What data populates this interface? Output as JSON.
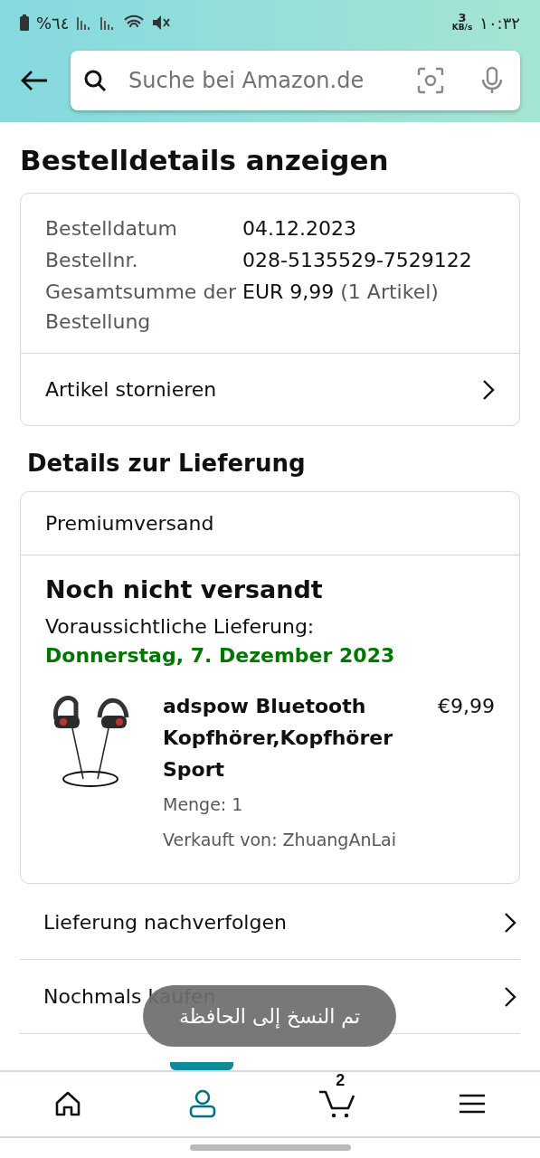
{
  "status_bar": {
    "battery": "%٦٤",
    "speed_value": "3",
    "speed_unit": "KB/s",
    "time": "١٠:٣٢"
  },
  "search": {
    "placeholder": "Suche bei Amazon.de"
  },
  "title": "Bestelldetails anzeigen",
  "order": {
    "rows": [
      {
        "label": "Bestelldatum",
        "value": "04.12.2023"
      },
      {
        "label": "Bestellnr.",
        "value": "028-5135529-7529122"
      },
      {
        "label": "Gesamtsumme der Bestellung",
        "value": "EUR 9,99",
        "note": "(1 Artikel)"
      }
    ],
    "action": "Artikel stornieren"
  },
  "delivery": {
    "heading": "Details zur Lieferung",
    "method": "Premiumversand",
    "status": "Noch nicht versandt",
    "expected_label": "Voraussichtliche Lieferung:",
    "expected_date": "Donnerstag, 7. Dezember 2023",
    "item": {
      "kind": "picture",
      "name": "adspow Bluetooth Kopfhörer,Kopfhörer Sport",
      "price": "€9,99",
      "quantity": "Menge: 1",
      "seller": "Verkauft von: ZhuangAnLai"
    }
  },
  "links": [
    "Lieferung nachverfolgen",
    "Nochmals kaufen"
  ],
  "toast": "تم النسخ إلى الحافظة",
  "nav": [
    {
      "kind": "home",
      "selected": false
    },
    {
      "kind": "account",
      "selected": true
    },
    {
      "kind": "cart",
      "selected": false,
      "count": "2"
    },
    {
      "kind": "menu",
      "selected": false
    }
  ]
}
